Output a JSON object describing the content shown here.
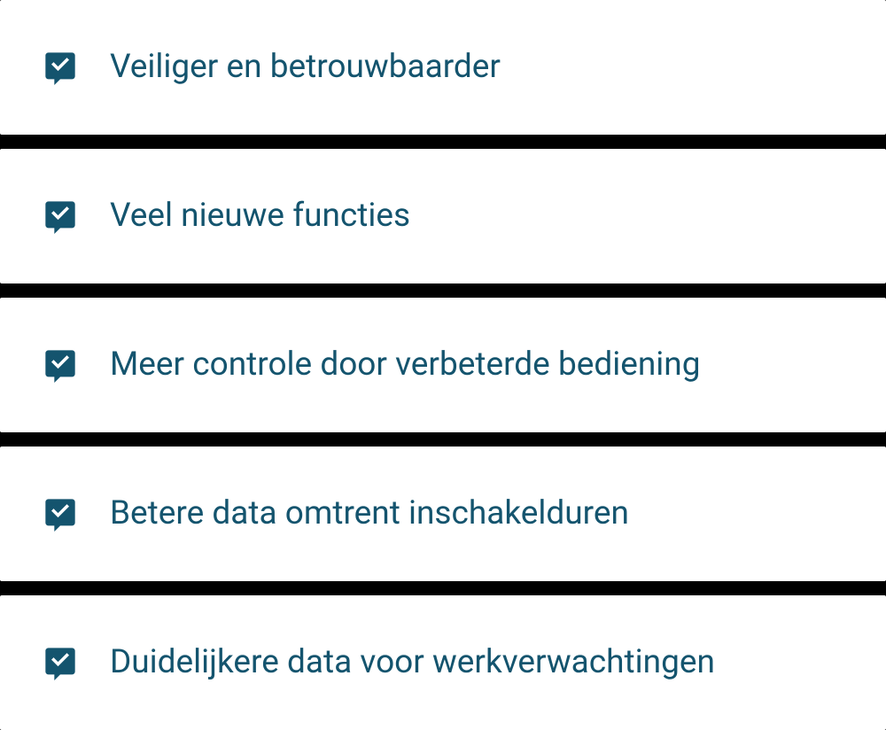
{
  "features": {
    "items": [
      {
        "label": "Veiliger en betrouwbaarder"
      },
      {
        "label": "Veel nieuwe functies"
      },
      {
        "label": "Meer controle door verbeterde bediening"
      },
      {
        "label": "Betere data omtrent inschakelduren"
      },
      {
        "label": "Duidelijkere data voor werkverwachtingen"
      }
    ]
  },
  "colors": {
    "primary": "#14546e",
    "card_bg": "#ffffff",
    "page_bg": "#000000"
  }
}
